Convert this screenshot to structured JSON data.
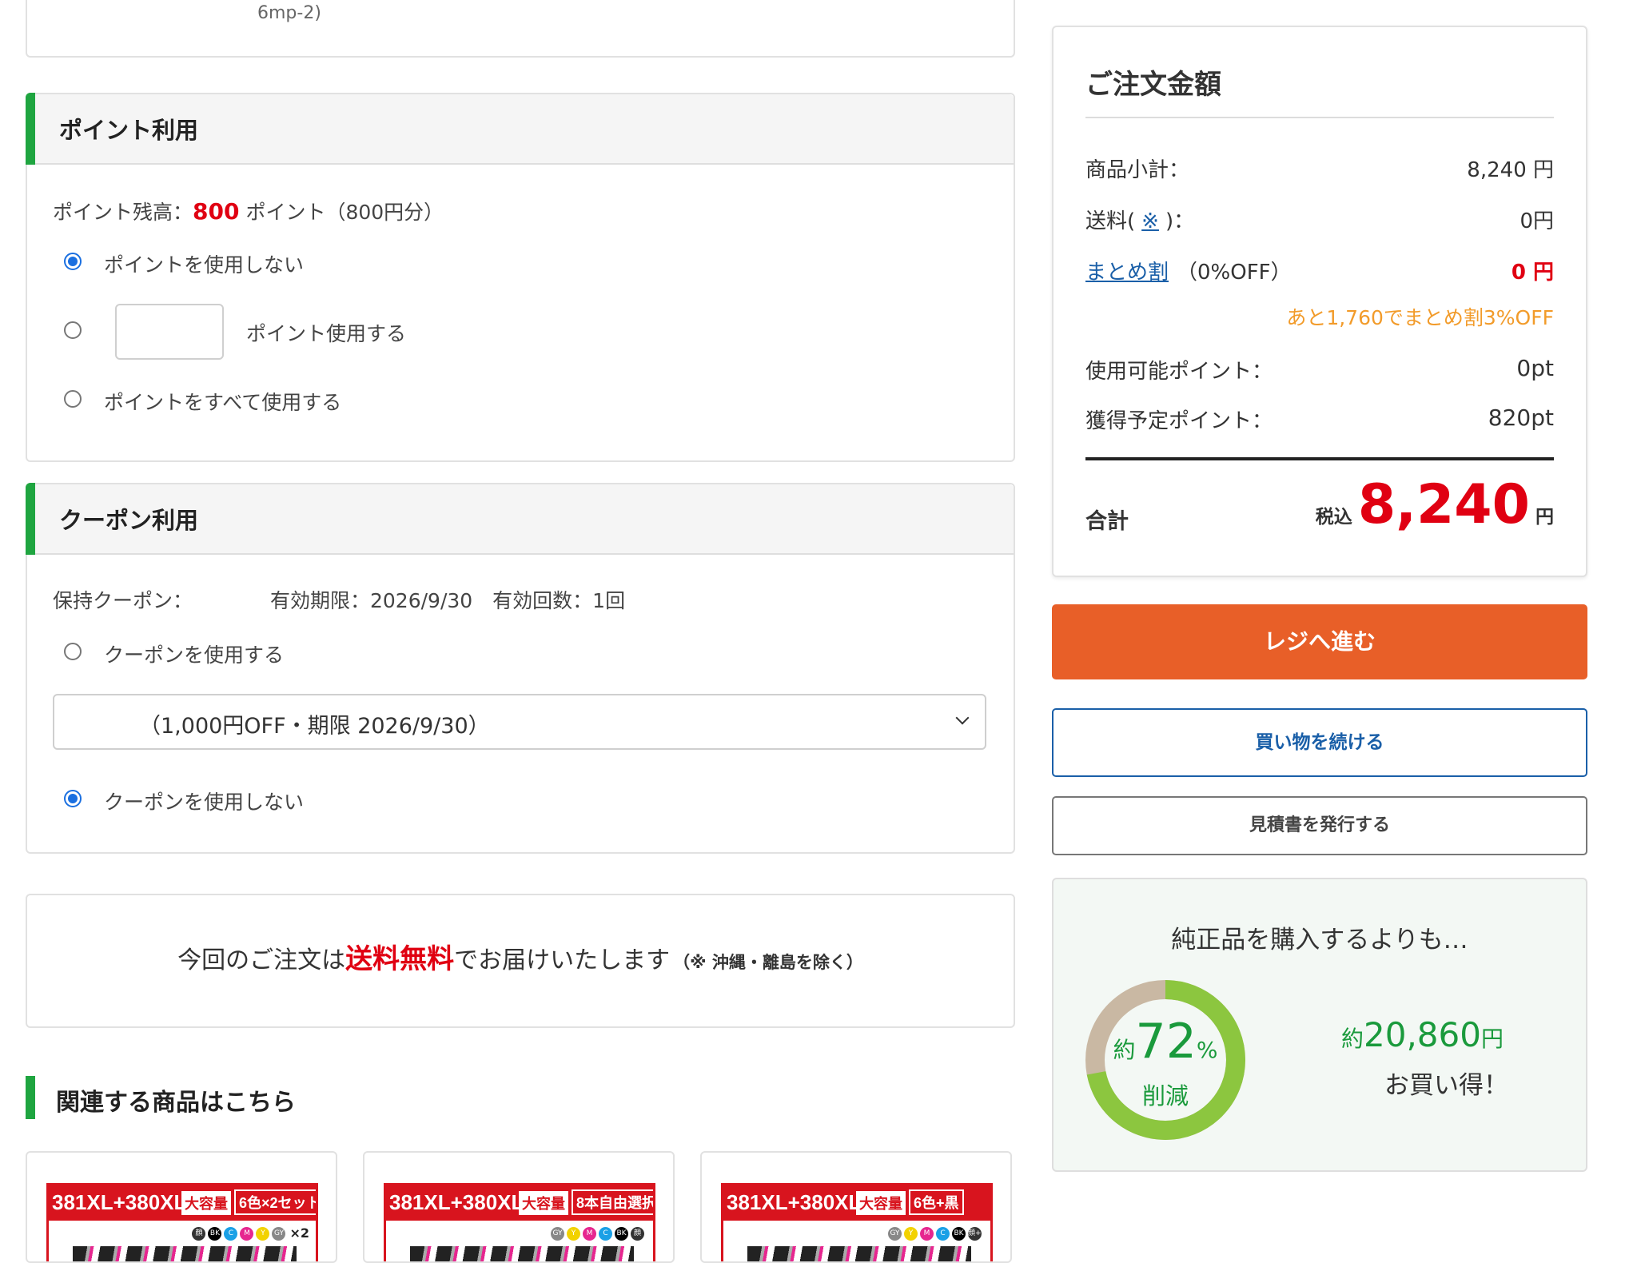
{
  "top_card": {
    "fragment": "6mp-2)"
  },
  "points": {
    "title": "ポイント利用",
    "balance_label": "ポイント残高：",
    "balance_value": "800",
    "balance_suffix": "ポイント（800円分）",
    "opt_none": "ポイントを使用しない",
    "opt_partial": "ポイント使用する",
    "opt_all": "ポイントをすべて使用する",
    "input_value": ""
  },
  "coupon": {
    "title": "クーポン利用",
    "held_label": "保持クーポン：",
    "held_info": "有効期限：2026/9/30　有効回数：1回",
    "opt_use": "クーポンを使用する",
    "select_value": "（1,000円OFF・期限 2026/9/30）",
    "opt_none": "クーポンを使用しない"
  },
  "shipping": {
    "pre": "今回のご注文は",
    "highlight": "送料無料",
    "post": "でお届けいたします",
    "note": "（※ 沖縄・離島を除く）"
  },
  "related": {
    "title": "関連する商品はこちら",
    "products": [
      {
        "model": "381XL+380XL",
        "tag1": "大容量",
        "tag2": "6色×2セット",
        "swatches": [
          "顔",
          "BK",
          "C",
          "M",
          "Y",
          "GY"
        ],
        "count": "×2"
      },
      {
        "model": "381XL+380XL",
        "tag1": "大容量",
        "tag2": "8本自由選択",
        "swatches": [
          "GY",
          "Y",
          "M",
          "C",
          "BK",
          "顔"
        ],
        "count": ""
      },
      {
        "model": "381XL+380XL",
        "tag1": "大容量",
        "tag2": "6色+黒",
        "swatches": [
          "GY",
          "Y",
          "M",
          "C",
          "BK",
          "顔+顔"
        ],
        "count": ""
      }
    ]
  },
  "summary": {
    "title": "ご注文金額",
    "subtotal_label": "商品小計：",
    "subtotal_value": "8,240 円",
    "shipping_label_pre": "送料(",
    "shipping_link": "※",
    "shipping_label_post": ")：",
    "shipping_value": "0円",
    "bulk_link": "まとめ割",
    "bulk_rate": "（0%OFF）",
    "bulk_value": "0 円",
    "bulk_hint": "あと1,760でまとめ割3%OFF",
    "avail_points_label": "使用可能ポイント：",
    "avail_points_value": "0pt",
    "earn_points_label": "獲得予定ポイント：",
    "earn_points_value": "820pt",
    "total_label": "合計",
    "tax_label": "税込",
    "total_value": "8,240",
    "total_unit": "円"
  },
  "buttons": {
    "checkout": "レジへ進む",
    "continue": "買い物を続ける",
    "estimate": "見積書を発行する"
  },
  "savings": {
    "heading": "純正品を購入するよりも…",
    "approx": "約",
    "percent": "72",
    "percent_sign": "%",
    "reduced": "削減",
    "amount_prefix": "約",
    "amount": "20,860",
    "amount_unit": "円",
    "tagline": "お買い得！",
    "fraction": 0.72
  },
  "colors": {
    "accent_green": "#1fa540",
    "price_red": "#e00012",
    "checkout_orange": "#e85f28",
    "link_blue": "#1a5fa8",
    "hint_orange": "#f29b2a",
    "ring_green": "#8cc63f",
    "ring_bg": "#c9b8a3"
  }
}
